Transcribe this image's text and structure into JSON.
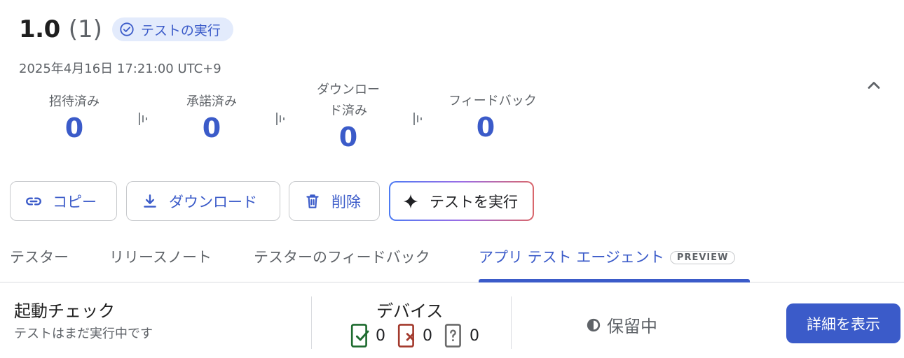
{
  "header": {
    "version": "1.0",
    "version_count": "(1)",
    "status_chip": "テストの実行",
    "date": "2025年4月16日 17:21:00 UTC+9"
  },
  "stats": [
    {
      "label": "招待済み",
      "value": "0"
    },
    {
      "label": "承諾済み",
      "value": "0"
    },
    {
      "label_line1": "ダウンロー",
      "label_line2": "ド済み",
      "value": "0"
    },
    {
      "label": "フィードバック",
      "value": "0"
    }
  ],
  "actions": {
    "copy": "コピー",
    "download": "ダウンロード",
    "delete": "削除",
    "run_test": "テストを実行"
  },
  "tabs": {
    "testers": "テスター",
    "release_notes": "リリースノート",
    "tester_feedback": "テスターのフィードバック",
    "app_test_agent": "アプリ テスト エージェント",
    "preview_badge": "PREVIEW"
  },
  "launch_check": {
    "title": "起動チェック",
    "subtitle": "テストはまだ実行中です"
  },
  "devices": {
    "title": "デバイス",
    "passed": "0",
    "failed": "0",
    "unknown": "0"
  },
  "pending": "保留中",
  "details_button": "詳細を表示",
  "colors": {
    "accent": "#3b5bc9",
    "chip_bg": "#e3ebfc",
    "pass": "#1e6b2f",
    "fail": "#a33a2d",
    "unknown": "#6b6b6b"
  }
}
